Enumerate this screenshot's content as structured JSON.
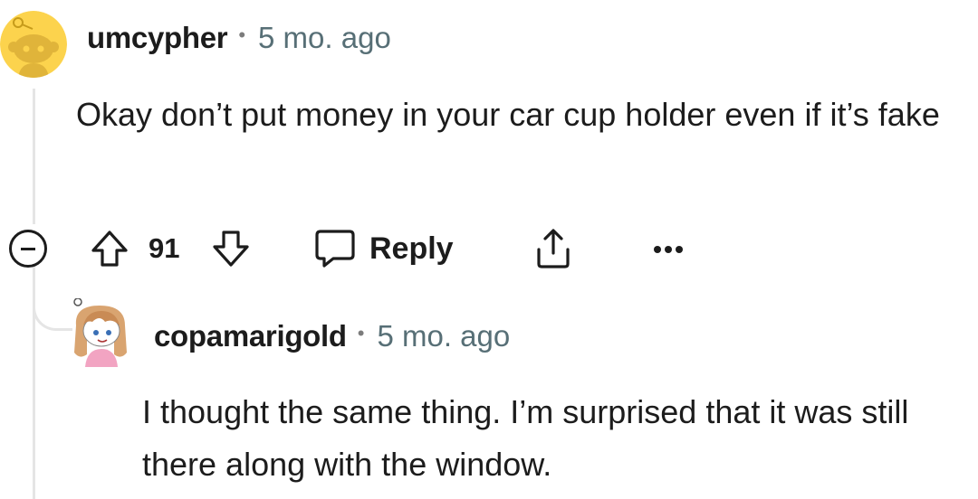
{
  "comments": [
    {
      "avatar": "snoo-yellow-avatar",
      "username": "umcypher",
      "separator": "•",
      "timestamp": "5 mo. ago",
      "body": "Okay don’t put money in your car cup holder even if it’s fake",
      "vote_count": "91",
      "reply_label": "Reply"
    },
    {
      "avatar": "custom-snoo-avatar",
      "username": "copamarigold",
      "separator": "•",
      "timestamp": "5 mo. ago",
      "body": "I thought the same thing. I’m surprised that it was still there along with the window."
    }
  ],
  "icons": {
    "collapse": "collapse-icon",
    "upvote": "upvote-arrow-icon",
    "downvote": "downvote-arrow-icon",
    "reply": "comment-bubble-icon",
    "share": "share-icon",
    "more": "more-options-icon"
  },
  "colors": {
    "text": "#1c1c1c",
    "meta": "#576f76",
    "thread_line": "#e5e5e5",
    "op_avatar_bg": "#fcd34d"
  }
}
